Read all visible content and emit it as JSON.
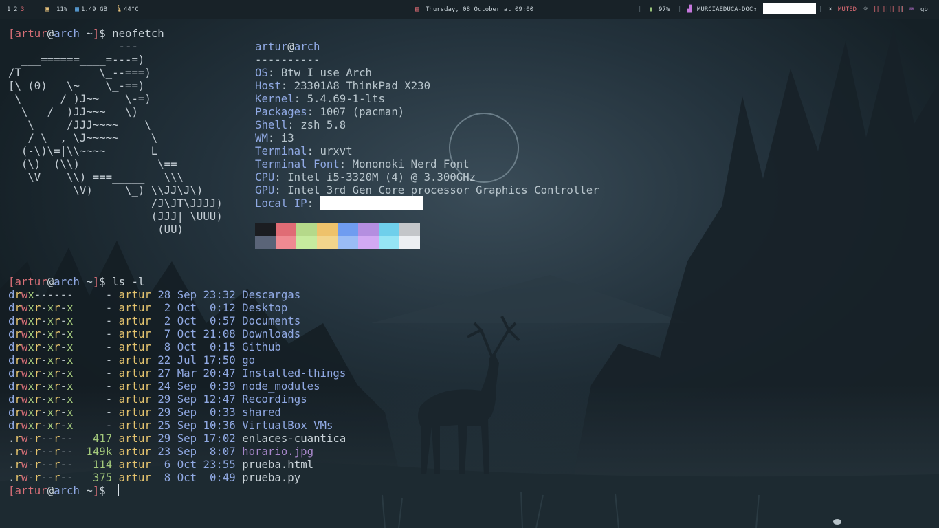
{
  "bar": {
    "workspaces": [
      "1",
      "2",
      "3"
    ],
    "workspace_active": "3",
    "cpu": "11%",
    "memory": "1.49 GB",
    "temp": "44°C",
    "date": "Thursday, 08 October at 09:00",
    "battery": "97%",
    "network": "MURCIAEDUCA-DOC",
    "network_arrow": "⇕",
    "volume": "MUTED",
    "brightness_bars": "||||||||||",
    "keyboard": "gb",
    "icons": {
      "cpu": "chip-icon",
      "memory": "memory-icon",
      "temp": "thermometer-icon",
      "date": "calendar-icon",
      "battery": "battery-icon",
      "network": "signal-icon",
      "volume": "mute-icon",
      "brightness": "brightness-icon",
      "keyboard": "keyboard-icon"
    },
    "colors": {
      "accent_red": "#e06c75",
      "bar_bg": "#182228",
      "battery_green": "#9fd47a"
    }
  },
  "terminal": {
    "prompt": {
      "open": "[",
      "user": "artur",
      "at": "@",
      "host": "arch",
      "dir": " ~",
      "close": "]",
      "sym": "$ "
    },
    "cmd1": "neofetch",
    "ascii": [
      "                 ---",
      "  ___======____=---=)",
      "/T            \\_--===)",
      "[\\ (0)   \\~    \\_-==)",
      " \\      / )J~~    \\-=)",
      "  \\___/  )JJ~~~   \\)",
      "   \\_____/JJJ~~~~    \\",
      "   / \\  , \\J~~~~~     \\",
      "  (-\\)\\=|\\\\~~~~       L__",
      "  (\\)  (\\\\)_           \\==__",
      "   \\V    \\\\) ===_____   \\\\\\",
      "          \\V)     \\_) \\\\JJ\\J\\)",
      "                      /J\\JT\\JJJJ)",
      "                      (JJJ| \\UUU)",
      "                       (UU)"
    ],
    "info": {
      "title_user": "artur",
      "title_at": "@",
      "title_host": "arch",
      "separator": "----------",
      "rows": [
        {
          "key": "OS",
          "value": "Btw I use Arch"
        },
        {
          "key": "Host",
          "value": "23301A8 ThinkPad X230"
        },
        {
          "key": "Kernel",
          "value": "5.4.69-1-lts"
        },
        {
          "key": "Packages",
          "value": "1007 (pacman)"
        },
        {
          "key": "Shell",
          "value": "zsh 5.8"
        },
        {
          "key": "WM",
          "value": "i3"
        },
        {
          "key": "Terminal",
          "value": "urxvt"
        },
        {
          "key": "Terminal Font",
          "value": "Mononoki Nerd Font"
        },
        {
          "key": "CPU",
          "value": "Intel i5-3320M (4) @ 3.300GHz"
        },
        {
          "key": "GPU",
          "value": "Intel 3rd Gen Core processor Graphics Controller"
        },
        {
          "key": "Local IP",
          "value": ""
        }
      ],
      "palette_top": [
        "#1b1d21",
        "#e06c75",
        "#b5d98a",
        "#eec26b",
        "#6f9cf0",
        "#b48ee0",
        "#6fcfeb",
        "#c3c6c9"
      ],
      "palette_bottom": [
        "#5a6478",
        "#ef8a92",
        "#c6eb9e",
        "#f2d58c",
        "#9abcf5",
        "#d2a9f3",
        "#96e5f5",
        "#eceff2"
      ]
    },
    "cmd2": "ls -l",
    "ls_rows": [
      {
        "perms": "drwx------",
        "size": "-",
        "user": "artur",
        "day": "28",
        "mon": "Sep",
        "time": "23:32",
        "name": "Descargas",
        "kind": "dir"
      },
      {
        "perms": "drwxr-xr-x",
        "size": "-",
        "user": "artur",
        "day": "2",
        "mon": "Oct",
        "time": "0:12",
        "name": "Desktop",
        "kind": "dir"
      },
      {
        "perms": "drwxr-xr-x",
        "size": "-",
        "user": "artur",
        "day": "2",
        "mon": "Oct",
        "time": "0:57",
        "name": "Documents",
        "kind": "dir"
      },
      {
        "perms": "drwxr-xr-x",
        "size": "-",
        "user": "artur",
        "day": "7",
        "mon": "Oct",
        "time": "21:08",
        "name": "Downloads",
        "kind": "dir"
      },
      {
        "perms": "drwxr-xr-x",
        "size": "-",
        "user": "artur",
        "day": "8",
        "mon": "Oct",
        "time": "0:15",
        "name": "Github",
        "kind": "dir"
      },
      {
        "perms": "drwxr-xr-x",
        "size": "-",
        "user": "artur",
        "day": "22",
        "mon": "Jul",
        "time": "17:50",
        "name": "go",
        "kind": "dir"
      },
      {
        "perms": "drwxr-xr-x",
        "size": "-",
        "user": "artur",
        "day": "27",
        "mon": "Mar",
        "time": "20:47",
        "name": "Installed-things",
        "kind": "dir"
      },
      {
        "perms": "drwxr-xr-x",
        "size": "-",
        "user": "artur",
        "day": "24",
        "mon": "Sep",
        "time": "0:39",
        "name": "node_modules",
        "kind": "dir"
      },
      {
        "perms": "drwxr-xr-x",
        "size": "-",
        "user": "artur",
        "day": "29",
        "mon": "Sep",
        "time": "12:47",
        "name": "Recordings",
        "kind": "dir"
      },
      {
        "perms": "drwxr-xr-x",
        "size": "-",
        "user": "artur",
        "day": "29",
        "mon": "Sep",
        "time": "0:33",
        "name": "shared",
        "kind": "dir"
      },
      {
        "perms": "drwxr-xr-x",
        "size": "-",
        "user": "artur",
        "day": "25",
        "mon": "Sep",
        "time": "10:36",
        "name": "VirtualBox VMs",
        "kind": "dir"
      },
      {
        "perms": ".rw-r--r--",
        "size": "417",
        "user": "artur",
        "day": "29",
        "mon": "Sep",
        "time": "17:02",
        "name": "enlaces-cuantica",
        "kind": "file"
      },
      {
        "perms": ".rw-r--r--",
        "size": "149k",
        "user": "artur",
        "day": "23",
        "mon": "Sep",
        "time": "8:07",
        "name": "horario.jpg",
        "kind": "image"
      },
      {
        "perms": ".rw-r--r--",
        "size": "114",
        "user": "artur",
        "day": "6",
        "mon": "Oct",
        "time": "23:55",
        "name": "prueba.html",
        "kind": "file"
      },
      {
        "perms": ".rw-r--r--",
        "size": "375",
        "user": "artur",
        "day": "8",
        "mon": "Oct",
        "time": "0:49",
        "name": "prueba.py",
        "kind": "file"
      }
    ]
  }
}
